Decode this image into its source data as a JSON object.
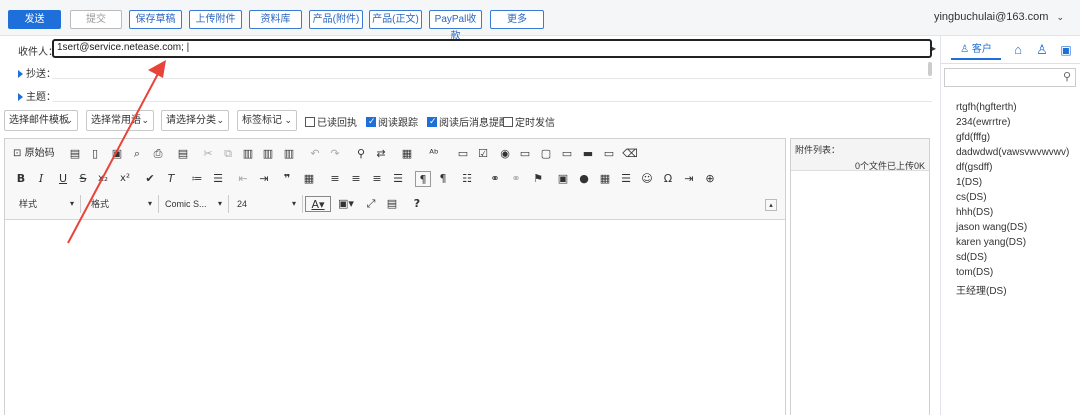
{
  "toolbar": {
    "send": "发送",
    "submit": "提交",
    "save_draft": "保存草稿",
    "upload_attachment": "上传附件",
    "library": "资料库",
    "product_attachment": "产品(附件)",
    "product_body": "产品(正文)",
    "paypal": "PayPal收款",
    "more": "更多"
  },
  "account": "yingbuchulai@163.com",
  "compose": {
    "to_label": "收件人：",
    "to_value": "1sert@service.netease.com; |",
    "cc_label": "抄送：",
    "subject_label": "主题："
  },
  "options": {
    "template": "选择邮件模板",
    "common_phrases": "选择常用语",
    "category": "请选择分类",
    "tag": "标签标记",
    "read_receipt": "已读回执",
    "read_tracking": "阅读跟踪",
    "read_reminder": "阅读后消息提醒",
    "scheduled": "定时发信"
  },
  "editor": {
    "source": "原始码",
    "style": "样式",
    "format": "格式",
    "font": "Comic S...",
    "size": "24"
  },
  "attachments": {
    "label": "附件列表：",
    "status": "0个文件已上传0K"
  },
  "sidebar": {
    "tab_customers": "客户",
    "contacts": [
      "rtgfh(hgfterth)",
      "234(ewrrtre)",
      "gfd(fffg)",
      "dadwdwd(vawsvwvwvwv)",
      "df(gsdff)",
      "1(DS)",
      "cs(DS)",
      "hhh(DS)",
      "jason wang(DS)",
      "karen yang(DS)",
      "sd(DS)",
      "tom(DS)",
      "王经理(DS)"
    ]
  },
  "colors": {
    "accent": "#1e6fd9",
    "arrow": "#e8443a"
  }
}
